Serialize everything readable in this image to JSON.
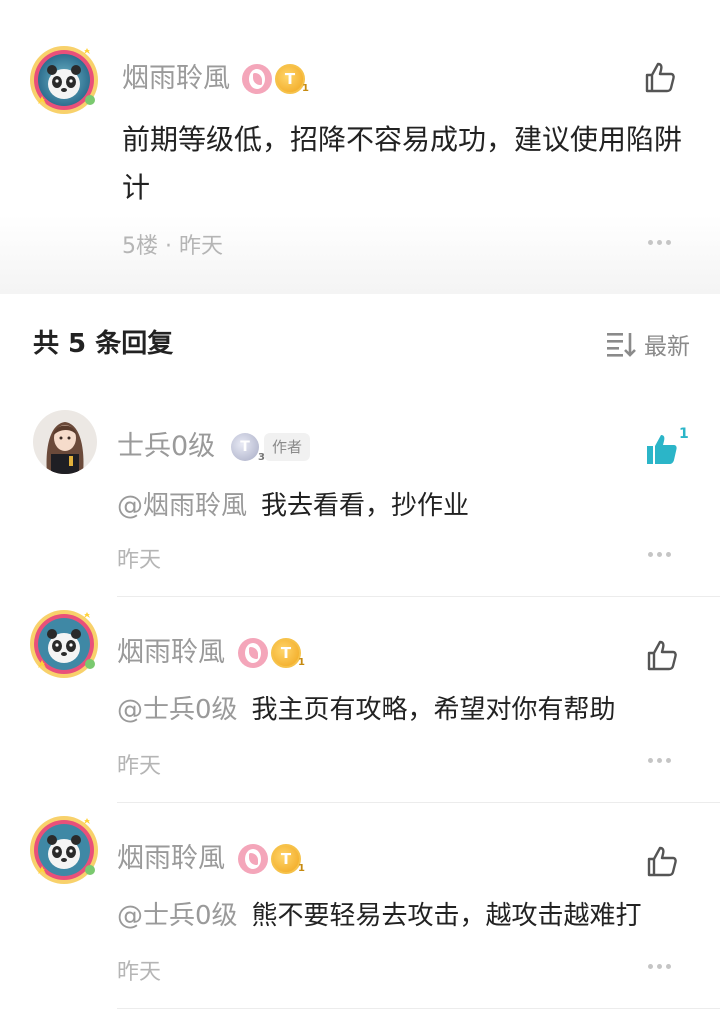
{
  "main_comment": {
    "user": "烟雨聆風",
    "text": "前期等级低，招降不容易成功，建议使用陷阱计",
    "floor": "5楼",
    "separator": "·",
    "time": "昨天",
    "badge_level": "T",
    "badge_sub": "1"
  },
  "replies_header": {
    "count_label": "共 5 条回复",
    "sort_label": "最新"
  },
  "replies": [
    {
      "user": "士兵0级",
      "badge_level": "T",
      "badge_sub": "3",
      "tag": "作者",
      "mention": "@烟雨聆風",
      "text": "我去看看，抄作业",
      "time": "昨天",
      "likes": "1",
      "liked": true
    },
    {
      "user": "烟雨聆風",
      "badge_level": "T",
      "badge_sub": "1",
      "mention": "@士兵0级",
      "text": "我主页有攻略，希望对你有帮助",
      "time": "昨天"
    },
    {
      "user": "烟雨聆風",
      "badge_level": "T",
      "badge_sub": "1",
      "mention": "@士兵0级",
      "text": "熊不要轻易去攻击，越攻击越难打",
      "time": "昨天"
    }
  ],
  "colors": {
    "accent_like": "#2bb5c8",
    "muted_text": "#9a9a9a",
    "badge_pink": "#f4a6ba",
    "badge_gold": "#f0a51d"
  },
  "icons": {
    "like": "thumbs-up-icon",
    "more": "more-dots-icon",
    "sort": "sort-list-icon"
  }
}
